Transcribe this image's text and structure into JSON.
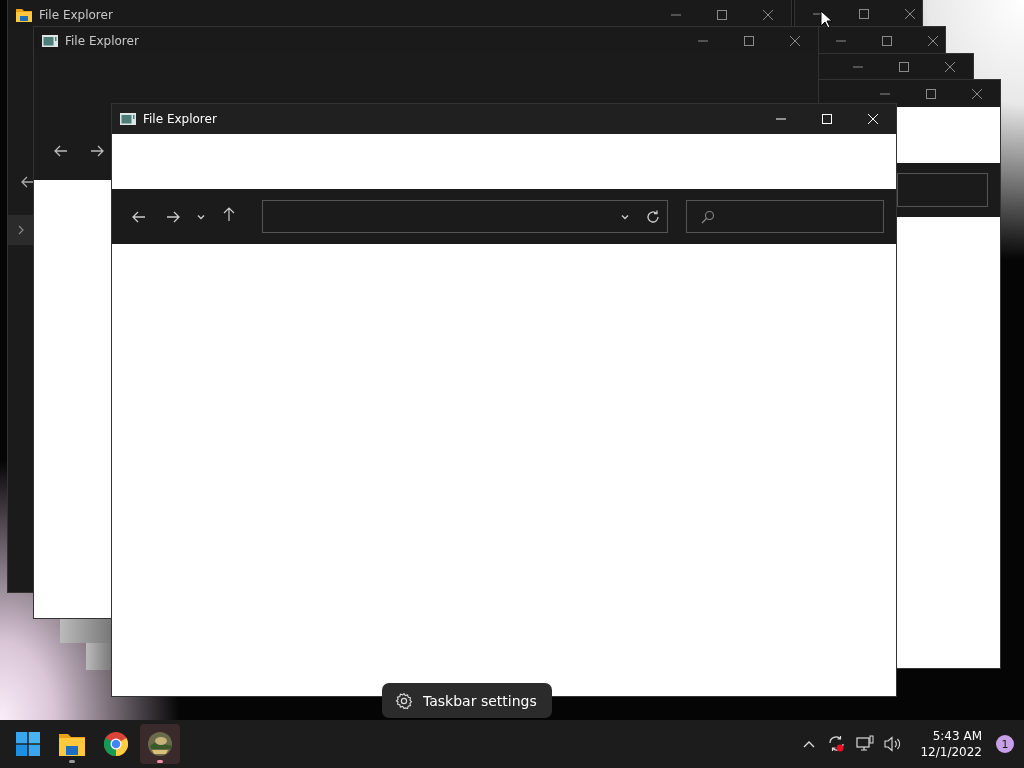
{
  "windows": [
    {
      "title": "File Explorer",
      "active": false
    },
    {
      "active": false
    },
    {
      "active": false
    },
    {
      "active": false
    },
    {
      "active": false
    },
    {
      "title": "File Explorer",
      "active": false
    },
    {
      "title": "File Explorer",
      "active": true
    }
  ],
  "tooltip": {
    "text": "Taskbar settings"
  },
  "taskbar": {
    "apps": [
      {
        "kind": "start",
        "running": false,
        "selected": false
      },
      {
        "kind": "file-explorer",
        "running": true,
        "selected": false
      },
      {
        "kind": "chrome",
        "running": false,
        "selected": false
      },
      {
        "kind": "game",
        "running": true,
        "selected": true
      }
    ],
    "clock": {
      "time": "5:43 AM",
      "date": "12/1/2022"
    },
    "notifications": "1"
  }
}
